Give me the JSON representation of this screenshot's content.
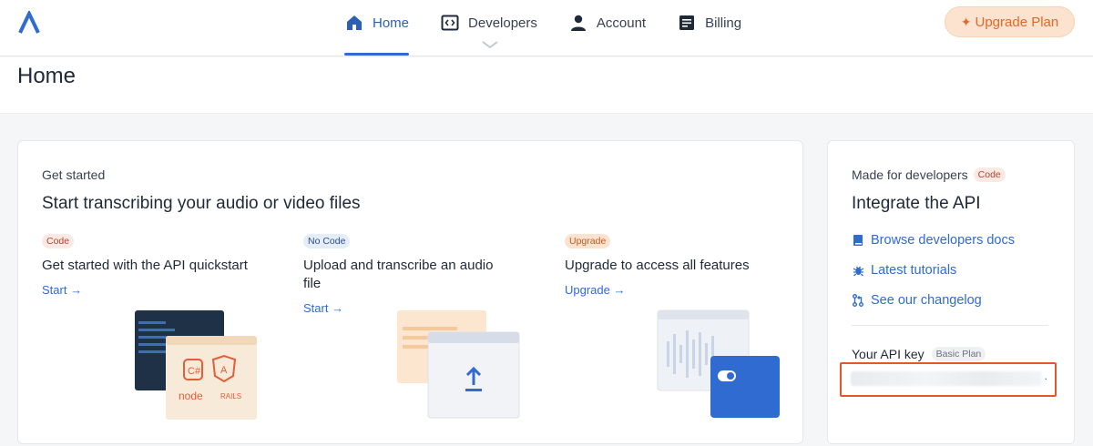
{
  "nav": {
    "items": [
      {
        "label": "Home",
        "icon": "home-icon"
      },
      {
        "label": "Developers",
        "icon": "code-window-icon"
      },
      {
        "label": "Account",
        "icon": "user-icon"
      },
      {
        "label": "Billing",
        "icon": "billing-icon"
      }
    ],
    "active": "Home",
    "upgrade_label": "Upgrade Plan"
  },
  "page": {
    "title": "Home"
  },
  "get_started": {
    "eyebrow": "Get started",
    "title": "Start transcribing your audio or video files",
    "columns": [
      {
        "tag": "Code",
        "title": "Get started with the API quickstart",
        "link": "Start →"
      },
      {
        "tag": "No Code",
        "title": "Upload and transcribe an audio file",
        "link": "Start →"
      },
      {
        "tag": "Upgrade",
        "title": "Upgrade to access all features",
        "link": "Upgrade →"
      }
    ]
  },
  "developers": {
    "eyebrow": "Made for developers",
    "tag": "Code",
    "title": "Integrate the API",
    "links": [
      {
        "label": "Browse developers docs",
        "icon": "book-icon"
      },
      {
        "label": "Latest tutorials",
        "icon": "bug-icon"
      },
      {
        "label": "See our changelog",
        "icon": "git-pull-request-icon"
      }
    ],
    "api_key_label": "Your API key",
    "plan_tag": "Basic Plan"
  },
  "colors": {
    "accent": "#2f6bd1",
    "upgrade": "#e06a2b",
    "highlight": "#e4572e"
  }
}
